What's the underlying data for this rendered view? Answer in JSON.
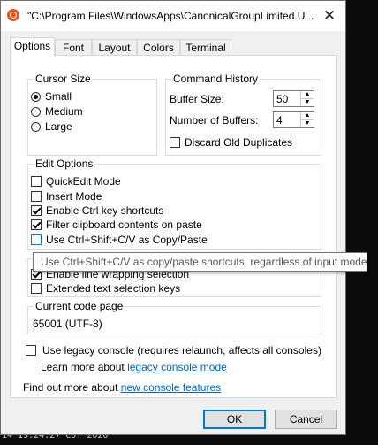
{
  "background": {
    "bottom_text": "14 19:24:27 CDT 2020"
  },
  "window": {
    "title": "\"C:\\Program Files\\WindowsApps\\CanonicalGroupLimited.U...",
    "close_glyph": "✕"
  },
  "tabs": [
    {
      "label": "Options",
      "active": true
    },
    {
      "label": "Font"
    },
    {
      "label": "Layout"
    },
    {
      "label": "Colors"
    },
    {
      "label": "Terminal"
    }
  ],
  "cursor_size": {
    "label": "Cursor Size",
    "options": [
      {
        "label": "Small",
        "selected": true
      },
      {
        "label": "Medium",
        "selected": false
      },
      {
        "label": "Large",
        "selected": false
      }
    ]
  },
  "command_history": {
    "label": "Command History",
    "buffer_size_label": "Buffer Size:",
    "buffer_size_value": "50",
    "number_buffers_label": "Number of Buffers:",
    "number_buffers_value": "4",
    "discard_label": "Discard Old Duplicates",
    "discard_checked": false
  },
  "edit_options": {
    "label": "Edit Options",
    "items": [
      {
        "label": "QuickEdit Mode",
        "checked": false
      },
      {
        "label": "Insert Mode",
        "checked": false
      },
      {
        "label": "Enable Ctrl key shortcuts",
        "checked": true
      },
      {
        "label": "Filter clipboard contents on paste",
        "checked": true
      },
      {
        "label": "Use Ctrl+Shift+C/V as Copy/Paste",
        "checked": false
      }
    ]
  },
  "text_selection": {
    "items": [
      {
        "label": "Enable line wrapping selection",
        "checked": true
      },
      {
        "label": "Extended text selection keys",
        "checked": false
      }
    ]
  },
  "code_page": {
    "label": "Current code page",
    "value": "65001 (UTF-8)"
  },
  "legacy": {
    "label": "Use legacy console (requires relaunch, affects all consoles)",
    "checked": false,
    "learn_prefix": "Learn more about",
    "learn_link": "legacy console mode"
  },
  "find_out": {
    "prefix": "Find out more about",
    "link": "new console features"
  },
  "buttons": {
    "ok": "OK",
    "cancel": "Cancel"
  },
  "tooltip": "Use Ctrl+Shift+C/V as copy/paste shortcuts, regardless of input mode",
  "colors": {
    "accent": "#0078d7",
    "link": "#0066cc",
    "ubuntu": "#e95420"
  }
}
